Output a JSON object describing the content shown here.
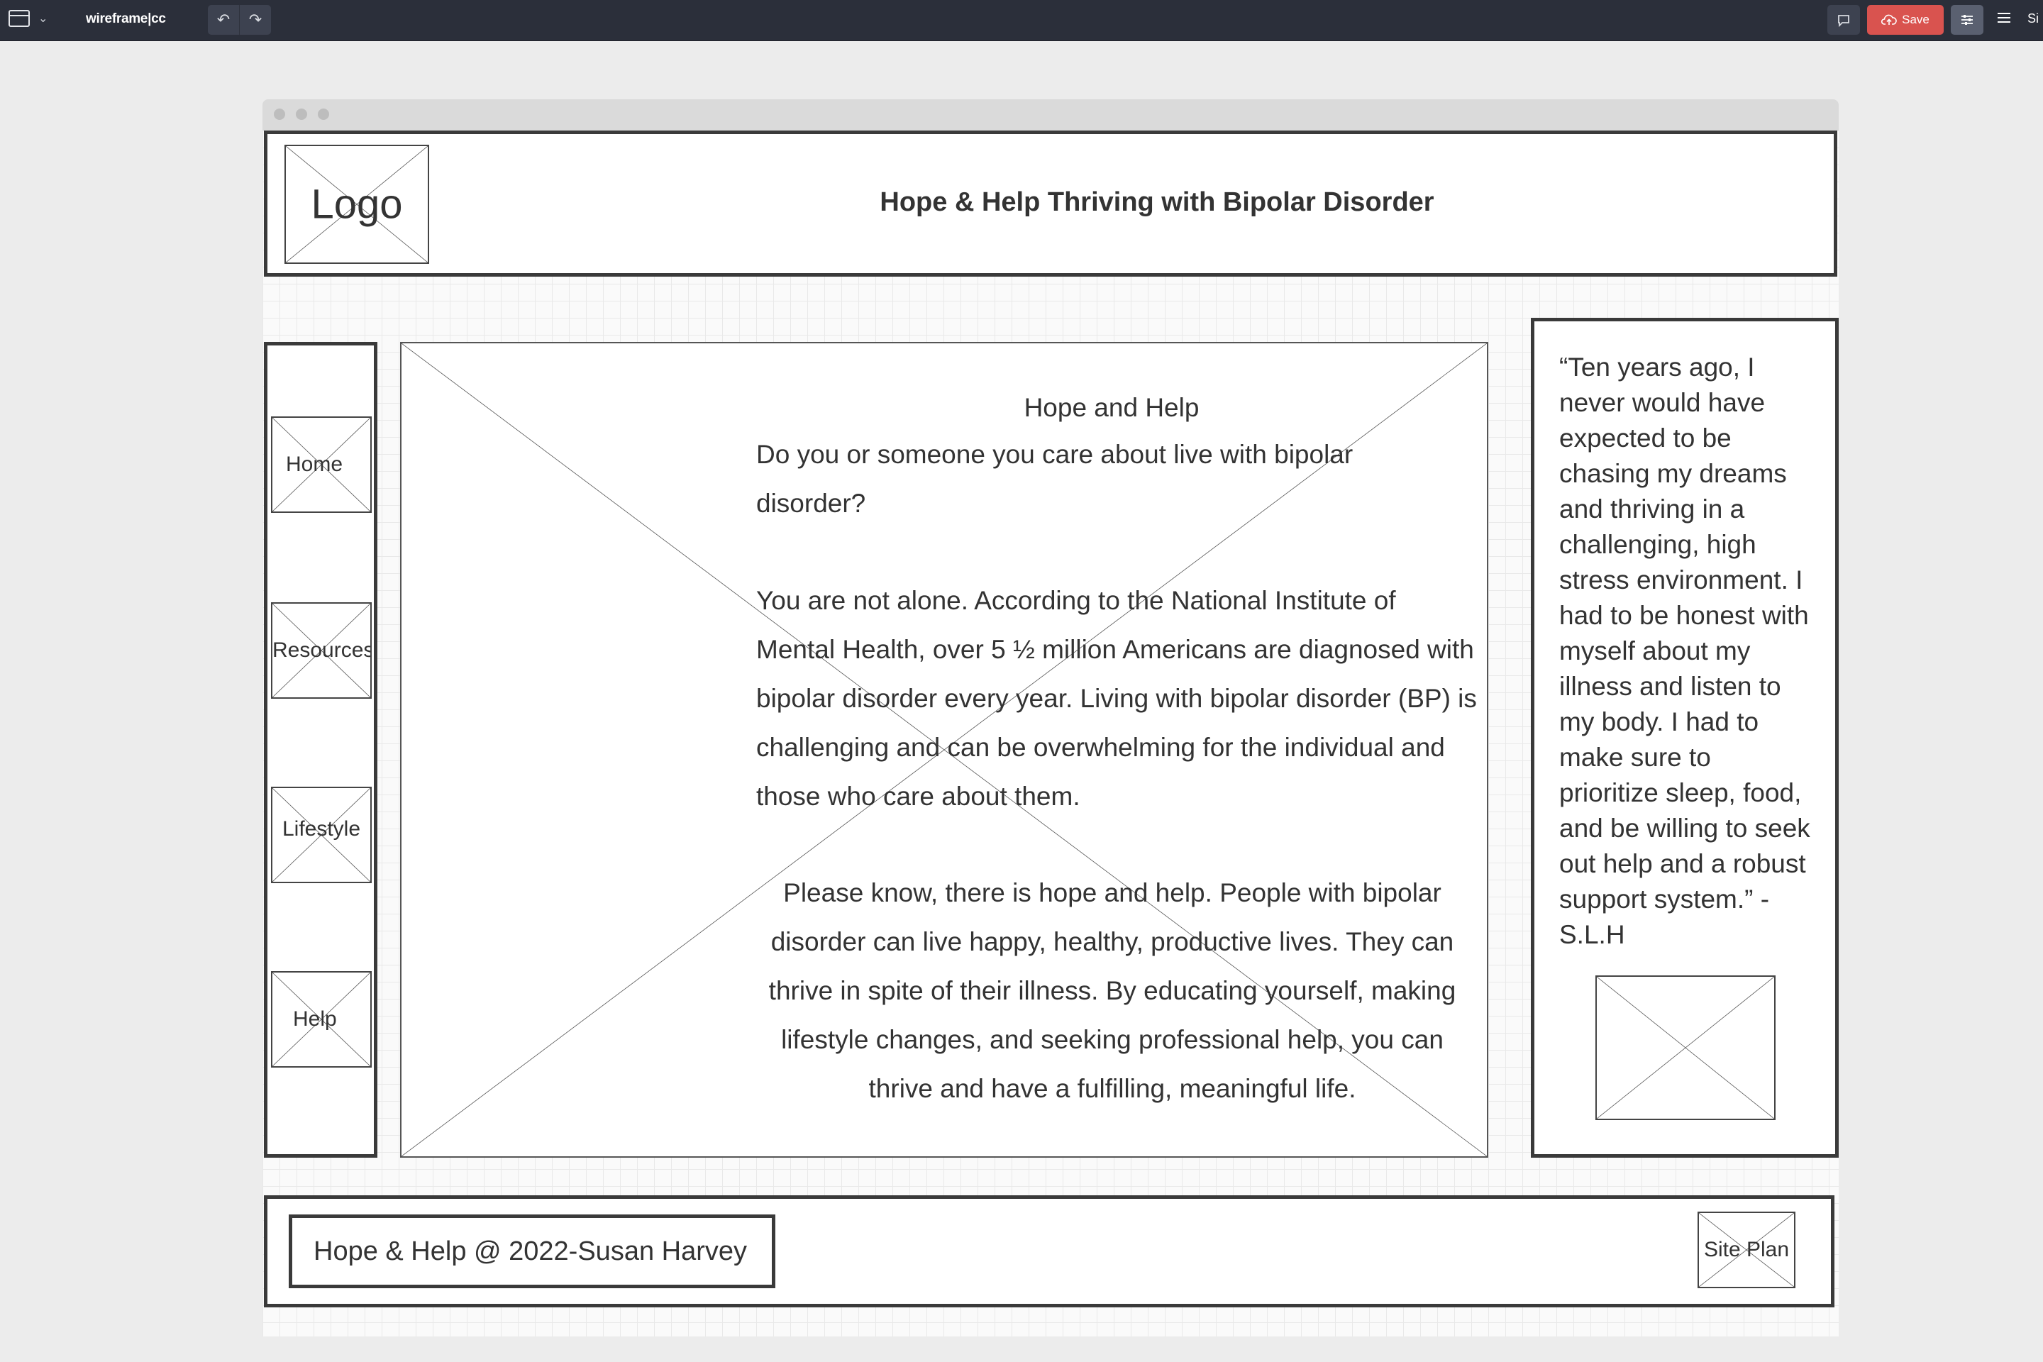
{
  "toolbar": {
    "app_name": "wireframe|cc",
    "save_label": "Save",
    "sign_label": "Si",
    "icons": [
      "window-icon",
      "chevron-down-icon",
      "undo-icon",
      "redo-icon",
      "comment-icon",
      "cloud-upload-icon",
      "settings-icon",
      "menu-icon"
    ]
  },
  "header": {
    "logo_label": "Logo",
    "title": "Hope & Help Thriving with Bipolar Disorder"
  },
  "nav": {
    "items": [
      {
        "label": "Home"
      },
      {
        "label": "Resources"
      },
      {
        "label": "Lifestyle"
      },
      {
        "label": "Help"
      }
    ]
  },
  "main": {
    "heading": "Hope and Help",
    "question": "Do you or someone you care about live with bipolar disorder?",
    "paragraph1": "You are not alone. According to the National Institute of Mental Health, over 5 ½ million Americans are diagnosed with bipolar disorder every year. Living with bipolar disorder (BP) is challenging and can be overwhelming for the individual and those who care about them.",
    "paragraph2": "Please know, there is hope and help. People with bipolar disorder can live happy, healthy, productive lives. They can thrive in spite of their illness. By educating yourself, making lifestyle changes, and seeking professional help, you can thrive and have a fulfilling, meaningful life."
  },
  "sidebar": {
    "quote": "“Ten years ago, I never would have expected to be chasing my dreams and thriving in a challenging, high stress environment. I had to be honest with myself about my illness and listen to my body. I had to make sure to prioritize sleep, food, and be willing to seek out help and a robust support system.” -S.L.H"
  },
  "footer": {
    "copyright": "Hope & Help @ 2022-Susan Harvey",
    "site_plan_label": "Site Plan"
  },
  "colors": {
    "toolbar_bg": "#2b2f3a",
    "save_button": "#d9534f",
    "canvas_bg": "#fafafa",
    "border": "#3a3a3a"
  }
}
